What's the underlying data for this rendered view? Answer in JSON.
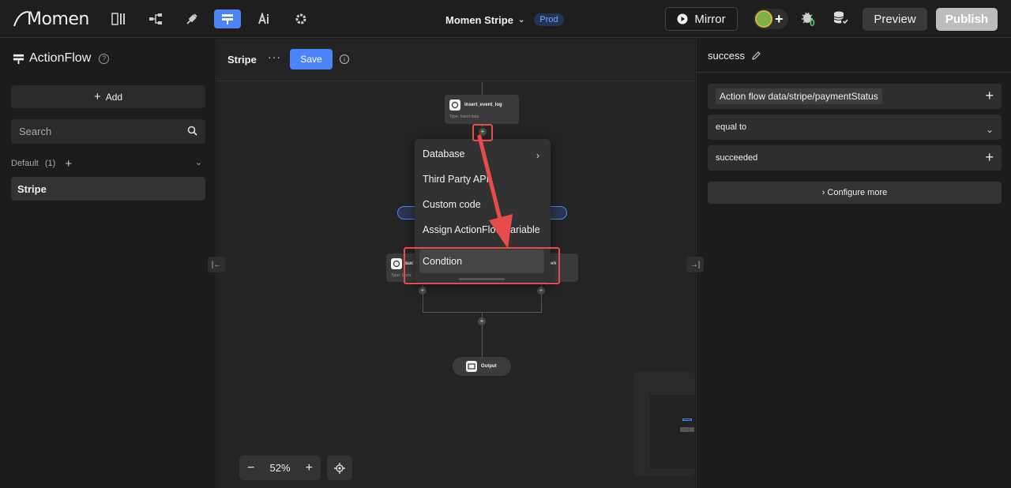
{
  "topbar": {
    "logo_text": "Momen",
    "nav_icons": [
      "layout-icon",
      "tree-icon",
      "plug-icon",
      "actionflow-icon",
      "ai-icon",
      "gear-icon"
    ],
    "project_name": "Momen Stripe",
    "env_badge": "Prod",
    "mirror_label": "Mirror",
    "bug_count": "0",
    "preview_label": "Preview",
    "publish_label": "Publish"
  },
  "sidebar": {
    "title": "ActionFlow",
    "add_label": "Add",
    "search_placeholder": "Search",
    "group_label": "Default",
    "group_count": "(1)",
    "items": [
      {
        "label": "Stripe"
      }
    ]
  },
  "canvas": {
    "flow_title": "Stripe",
    "more_label": "···",
    "save_label": "Save",
    "zoom_value": "52%",
    "nodes": {
      "insert": {
        "name": "insert_event_log",
        "type": "Type:   Insert data"
      },
      "success": {
        "name": "suc",
        "type": "Type: Upda"
      },
      "right_partial": {
        "name": "en"
      },
      "output": {
        "name": "Output"
      }
    },
    "menu": {
      "items": [
        {
          "label": "Database"
        },
        {
          "label": "Third Party API"
        },
        {
          "label": "Custom code"
        },
        {
          "label": "Assign ActionFlow variable"
        },
        {
          "label": "Condtion"
        }
      ]
    }
  },
  "right_panel": {
    "title": "success",
    "source_value": "Action flow data/stripe/paymentStatus",
    "operator_value": "equal to",
    "compare_value": "succeeded",
    "configure_label": "Configure more"
  },
  "colors": {
    "accent": "#4a86f7",
    "highlight": "#e84b4b",
    "background": "#1b1b1b",
    "canvas": "#242424"
  }
}
